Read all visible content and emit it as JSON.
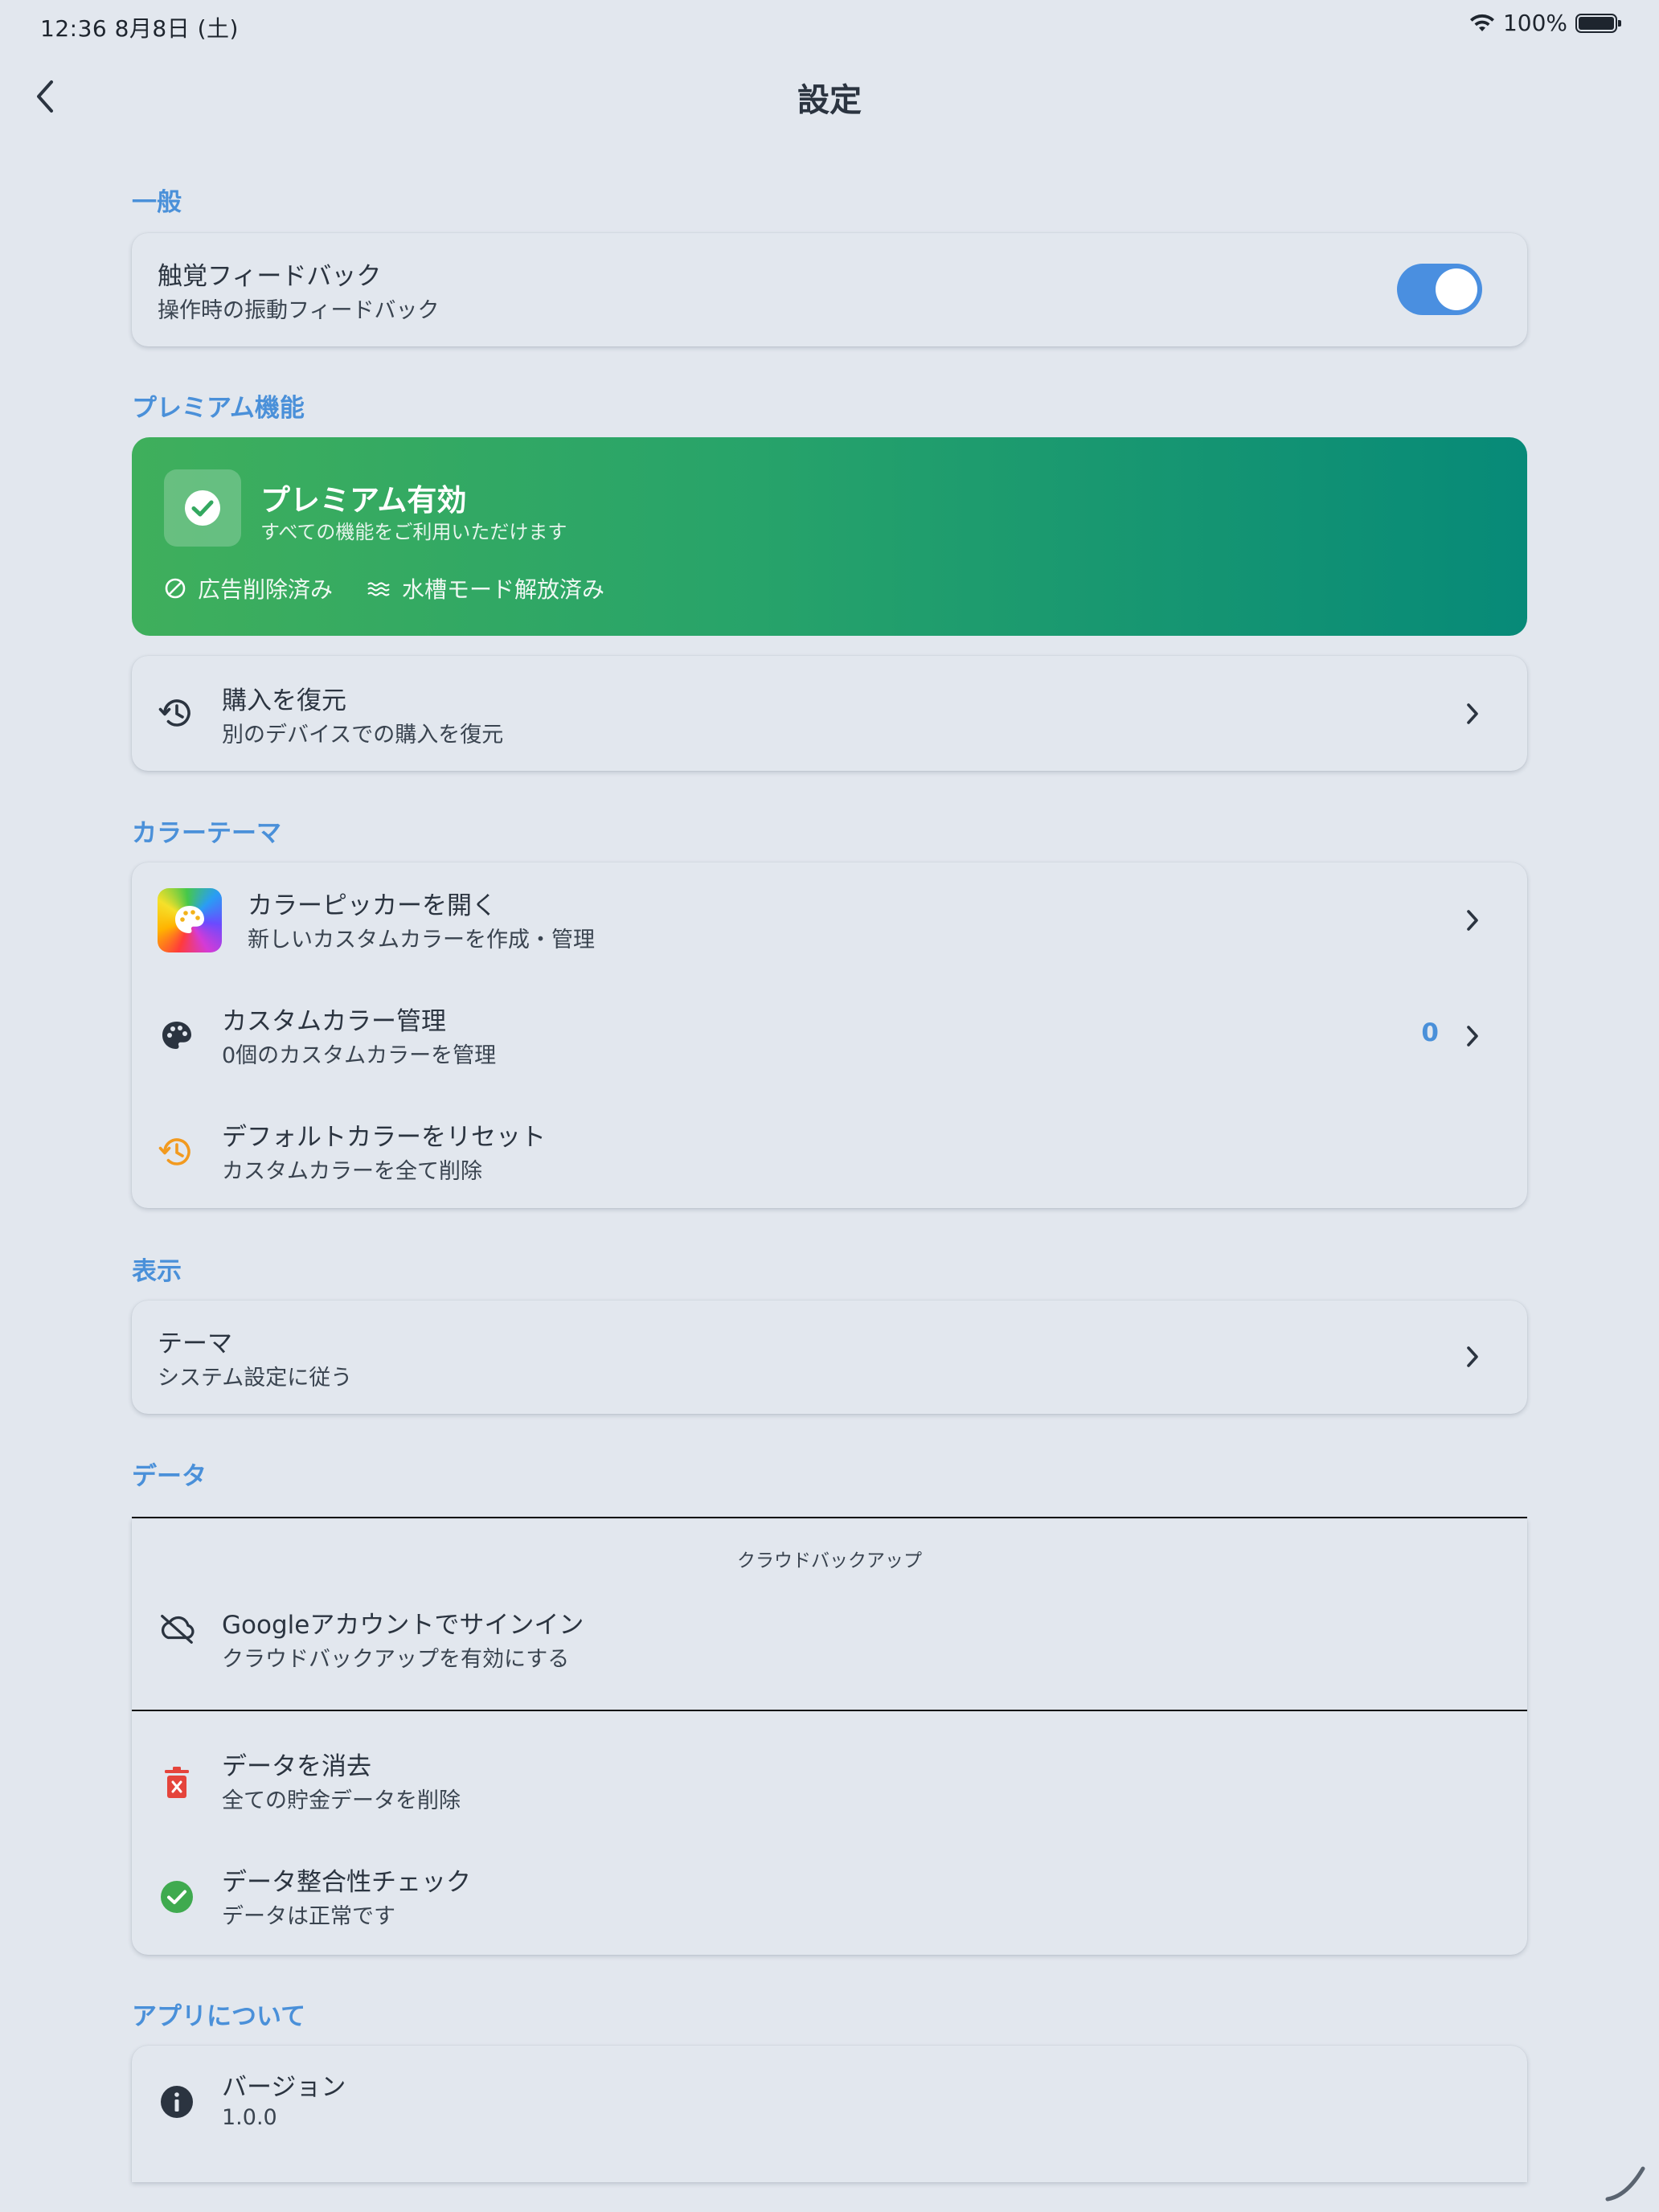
{
  "status_bar": {
    "time_date": "12:36   8月8日 (土)",
    "battery": "100%"
  },
  "header": {
    "title": "設定"
  },
  "sections": {
    "general": "一般",
    "premium": "プレミアム機能",
    "color_theme": "カラーテーマ",
    "display": "表示",
    "data": "データ",
    "about": "アプリについて"
  },
  "haptic": {
    "title": "触覚フィードバック",
    "subtitle": "操作時の振動フィードバック",
    "enabled": true
  },
  "premium": {
    "title": "プレミアム有効",
    "subtitle": "すべての機能をご利用いただけます",
    "features": [
      "広告削除済み",
      "水槽モード解放済み"
    ]
  },
  "restore": {
    "title": "購入を復元",
    "subtitle": "別のデバイスでの購入を復元"
  },
  "color_picker": {
    "title": "カラーピッカーを開く",
    "subtitle": "新しいカスタムカラーを作成・管理"
  },
  "custom_colors": {
    "title": "カスタムカラー管理",
    "subtitle": "0個のカスタムカラーを管理",
    "count": "0"
  },
  "reset_colors": {
    "title": "デフォルトカラーをリセット",
    "subtitle": "カスタムカラーを全て削除"
  },
  "theme": {
    "title": "テーマ",
    "subtitle": "システム設定に従う"
  },
  "cloud": {
    "header": "クラウドバックアップ",
    "title": "Googleアカウントでサインイン",
    "subtitle": "クラウドバックアップを有効にする"
  },
  "clear_data": {
    "title": "データを消去",
    "subtitle": "全ての貯金データを削除"
  },
  "integrity": {
    "title": "データ整合性チェック",
    "subtitle": "データは正常です"
  },
  "version": {
    "title": "バージョン",
    "subtitle": "1.0.0"
  },
  "colors": {
    "accent": "#4A90D9",
    "danger": "#E5443B",
    "success": "#3FAA4F",
    "warning": "#F29A1F"
  }
}
